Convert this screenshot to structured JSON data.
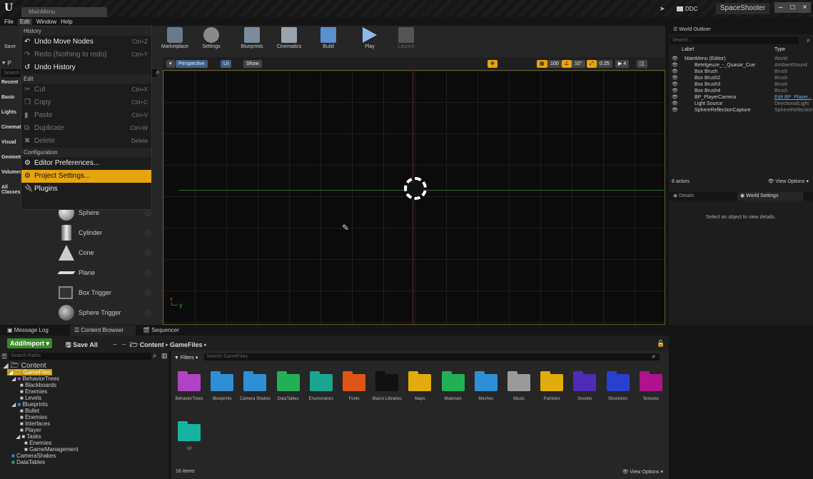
{
  "titlebar": {
    "tab": "MainMenu",
    "ddc": "DDC",
    "project": "SpaceShooter",
    "min": "–",
    "max": "□",
    "close": "×"
  },
  "menubar": [
    "File",
    "Edit",
    "Window",
    "Help"
  ],
  "toolbar": {
    "save": "Save",
    "items": [
      "Marketplace",
      "Settings",
      "Blueprints",
      "Cinematics",
      "Build",
      "Play",
      "Launch"
    ]
  },
  "leftpanel": {
    "mode_label": "P",
    "search": "Search",
    "tabs": [
      "Recent",
      "Basic",
      "Lights",
      "Cinematic",
      "Visual",
      "Geometry",
      "Volumes",
      "All Classes"
    ],
    "shapes": [
      "Sphere",
      "Cylinder",
      "Cone",
      "Plane",
      "Box Trigger",
      "Sphere Trigger"
    ]
  },
  "edit_menu": {
    "sections": [
      {
        "header": "History",
        "items": [
          {
            "label": "Undo Move Nodes",
            "shortcut": "Ctrl+Z",
            "enabled": true
          },
          {
            "label": "Redo (Nothing to redo)",
            "shortcut": "Ctrl+Y",
            "enabled": false
          },
          {
            "label": "Undo History",
            "shortcut": "",
            "enabled": true
          }
        ]
      },
      {
        "header": "Edit",
        "items": [
          {
            "label": "Cut",
            "shortcut": "Ctrl+X",
            "enabled": false
          },
          {
            "label": "Copy",
            "shortcut": "Ctrl+C",
            "enabled": false
          },
          {
            "label": "Paste",
            "shortcut": "Ctrl+V",
            "enabled": false
          },
          {
            "label": "Duplicate",
            "shortcut": "Ctrl+W",
            "enabled": false
          },
          {
            "label": "Delete",
            "shortcut": "Delete",
            "enabled": false
          }
        ]
      },
      {
        "header": "Configuration",
        "items": [
          {
            "label": "Editor Preferences...",
            "shortcut": "",
            "enabled": true
          },
          {
            "label": "Project Settings...",
            "shortcut": "",
            "enabled": true,
            "highlighted": true
          },
          {
            "label": "Plugins",
            "shortcut": "",
            "enabled": true
          }
        ]
      }
    ]
  },
  "viewport": {
    "perspective": "Perspective",
    "lit": "Lit",
    "show": "Show",
    "snap_grid": "100",
    "snap_angle": "10°",
    "scale": "0.25",
    "camspeed": "4"
  },
  "outliner": {
    "tab": "World Outliner",
    "search": "Search...",
    "col_label": "Label",
    "col_type": "Type",
    "rows": [
      {
        "label": "MainMenu (Editor)",
        "type": "World"
      },
      {
        "label": "Betelgeuze_-_Quasar_Cue",
        "type": "AmbientSound"
      },
      {
        "label": "Box Brush",
        "type": "Brush"
      },
      {
        "label": "Box Brush2",
        "type": "Brush"
      },
      {
        "label": "Box Brush3",
        "type": "Brush"
      },
      {
        "label": "Box Brush4",
        "type": "Brush"
      },
      {
        "label": "BP_PlayerCamera",
        "type": "Edit BP_Player..."
      },
      {
        "label": "Light Source",
        "type": "DirectionalLight"
      },
      {
        "label": "SphereReflectionCapture",
        "type": "SphereReflection"
      }
    ],
    "count": "8 actors",
    "view_options": "View Options"
  },
  "details": {
    "tab1": "Details",
    "tab2": "World Settings",
    "empty": "Select an object to view details."
  },
  "bottomtabs": [
    "Message Log",
    "Content Browser",
    "Sequencer"
  ],
  "content_browser": {
    "add": "Add/Import",
    "save": "Save All",
    "crumb1": "Content",
    "crumb2": "GameFiles",
    "search_paths": "Search Paths",
    "filters": "Filters",
    "search": "Search GameFiles",
    "tree": [
      "Content",
      "GameFiles",
      "BehaviorTrees",
      "Blackboards",
      "Enemies",
      "Levels",
      "Blueprints",
      "Bullet",
      "Enemies",
      "Interfaces",
      "Player",
      "Tasks",
      "Enemies",
      "GameManagement",
      "CameraShakes",
      "DataTables"
    ],
    "folders": [
      {
        "name": "BehaviorTrees",
        "color": "#b043c4"
      },
      {
        "name": "Blueprints",
        "color": "#2f8fd6"
      },
      {
        "name": "Camera Shakes",
        "color": "#2f8fd6"
      },
      {
        "name": "DataTables",
        "color": "#22b054"
      },
      {
        "name": "Enumerators",
        "color": "#19a590"
      },
      {
        "name": "Fonts",
        "color": "#e05416"
      },
      {
        "name": "Macro Libraries",
        "color": "#111111"
      },
      {
        "name": "Maps",
        "color": "#e2ac0c"
      },
      {
        "name": "Materials",
        "color": "#22b054"
      },
      {
        "name": "Meshes",
        "color": "#2f8fd6"
      },
      {
        "name": "Music",
        "color": "#9a9a9a"
      },
      {
        "name": "Particles",
        "color": "#e2ac0c"
      },
      {
        "name": "Sounds",
        "color": "#4e2cb8"
      },
      {
        "name": "Structures",
        "color": "#2a3fd0"
      },
      {
        "name": "Textures",
        "color": "#b0138e"
      },
      {
        "name": "UI",
        "color": "#15b4a0"
      }
    ],
    "count": "16 items",
    "view_options": "View Options"
  }
}
